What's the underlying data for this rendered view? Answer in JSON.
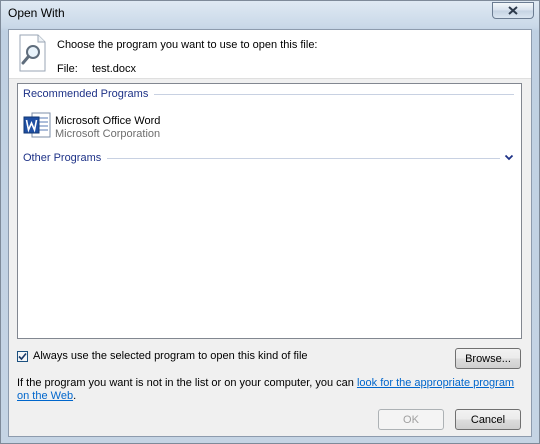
{
  "window": {
    "title": "Open With"
  },
  "header": {
    "prompt": "Choose the program you want to use to open this file:",
    "file_label": "File:",
    "file_name": "test.docx"
  },
  "programs": {
    "recommended_header": "Recommended Programs",
    "recommended": [
      {
        "name": "Microsoft Office Word",
        "publisher": "Microsoft Corporation",
        "icon": "word-icon"
      }
    ],
    "other_header": "Other Programs"
  },
  "options": {
    "always_use_label": "Always use the selected program to open this kind of file",
    "always_use_checked": true,
    "browse_label": "Browse..."
  },
  "help": {
    "text_before": "If the program you want is not in the list or on your computer, you can ",
    "link_text": "look for the appropriate program on the Web",
    "text_after": "."
  },
  "footer": {
    "ok_label": "OK",
    "cancel_label": "Cancel"
  },
  "colors": {
    "group_header": "#1e3287",
    "link": "#0066cc",
    "close_glyph": "#2d3a4b"
  }
}
